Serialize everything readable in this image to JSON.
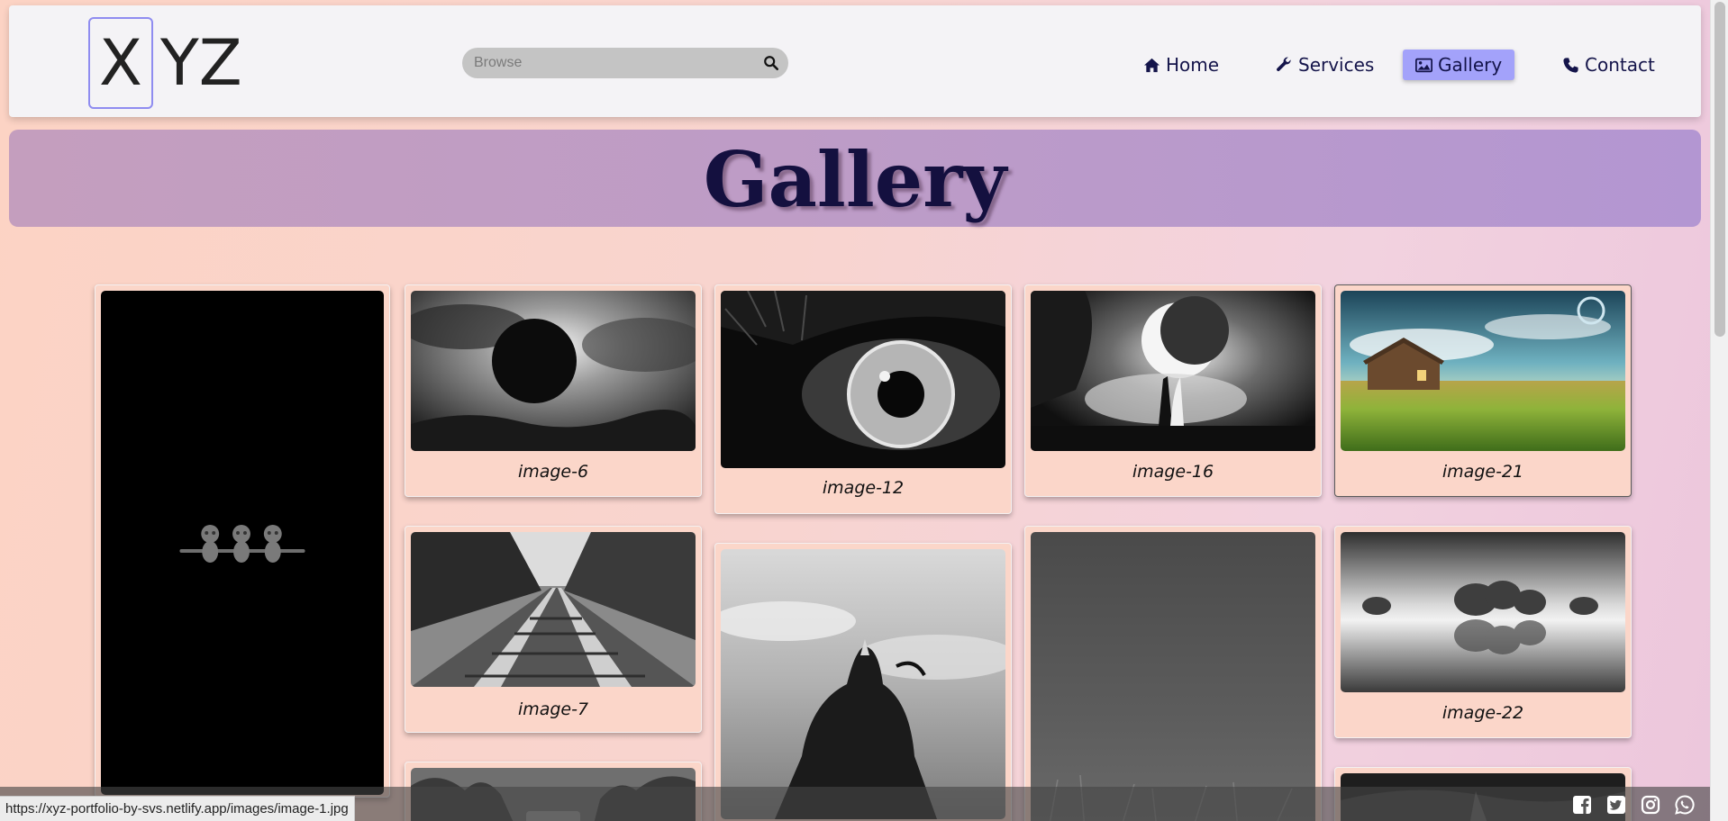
{
  "header": {
    "logo_first": "X",
    "logo_rest": "YZ",
    "search_placeholder": "Browse",
    "nav": [
      {
        "label": "Home",
        "icon": "home-icon"
      },
      {
        "label": "Services",
        "icon": "wrench-icon"
      },
      {
        "label": "Gallery",
        "icon": "image-icon",
        "active": true
      },
      {
        "label": "Contact",
        "icon": "phone-icon"
      }
    ]
  },
  "banner": {
    "title": "Gallery"
  },
  "gallery": {
    "captions": {
      "image_6": "image-6",
      "image_12": "image-12",
      "image_16": "image-16",
      "image_21": "image-21",
      "image_7": "image-7",
      "image_22": "image-22"
    }
  },
  "status_bar": {
    "url": "https://xyz-portfolio-by-svs.netlify.app/images/image-1.jpg"
  },
  "footer": {
    "social_icons": [
      "facebook-icon",
      "twitter-icon",
      "instagram-icon",
      "whatsapp-icon"
    ]
  },
  "colors": {
    "nav_active_bg": "#a3a2fa",
    "banner_bg": "#bd9cc7",
    "title_color": "#14103f",
    "card_bg": "#fbd6c9"
  }
}
